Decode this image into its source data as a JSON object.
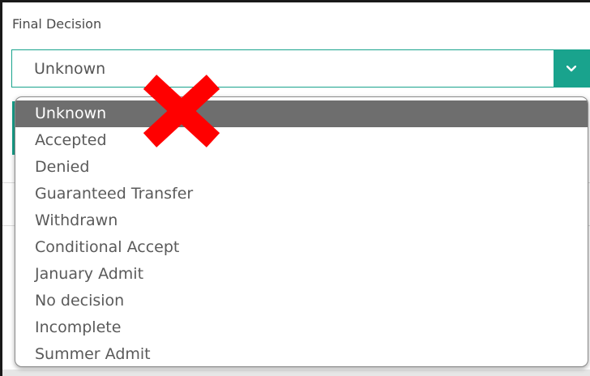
{
  "field": {
    "label": "Final Decision",
    "selected_value": "Unknown"
  },
  "dropdown": {
    "options": [
      "Unknown",
      "Accepted",
      "Denied",
      "Guaranteed Transfer",
      "Withdrawn",
      "Conditional Accept",
      "January Admit",
      "No decision",
      "Incomplete",
      "Summer Admit"
    ],
    "highlighted_index": 0
  },
  "colors": {
    "accent": "#19a38d",
    "highlight": "#6e6e6e",
    "annotation": "#ff0000"
  },
  "icons": {
    "select_arrow": "chevron-down-icon",
    "annotation": "red-x-icon"
  }
}
